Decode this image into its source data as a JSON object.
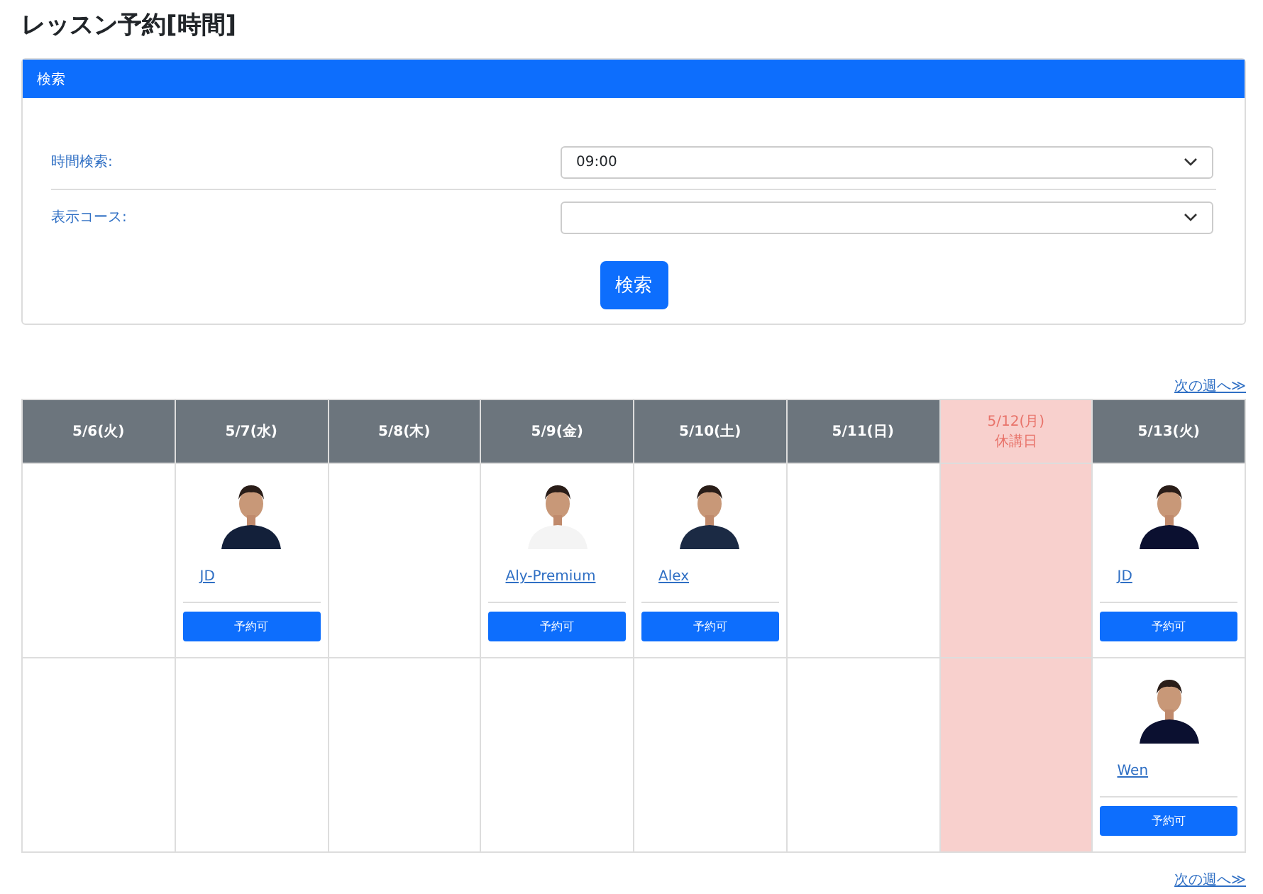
{
  "page": {
    "title": "レッスン予約[時間]"
  },
  "search": {
    "header": "検索",
    "fields": [
      {
        "label": "時間検索:",
        "value": "09:00"
      },
      {
        "label": "表示コース:"
      }
    ],
    "button": "検索"
  },
  "next_week_top": "次の週へ≫",
  "schedule": {
    "columns": [
      {
        "date": "5/6(火)",
        "holiday": false
      },
      {
        "date": "5/7(水)",
        "holiday": false
      },
      {
        "date": "5/8(木)",
        "holiday": false
      },
      {
        "date": "5/9(金)",
        "holiday": false
      },
      {
        "date": "5/10(土)",
        "holiday": false
      },
      {
        "date": "5/11(日)",
        "holiday": false
      },
      {
        "date": "5/12(月)",
        "holiday": true,
        "note": "休講日"
      },
      {
        "date": "5/13(火)",
        "holiday": false
      }
    ],
    "rows": [
      {
        "cells": [
          {
            "kind": "empty"
          },
          {
            "kind": "lesson",
            "teacher": "JD",
            "button": "予約可"
          },
          {
            "kind": "empty"
          },
          {
            "kind": "lesson",
            "teacher": "Aly-Premium",
            "button": "予約可"
          },
          {
            "kind": "lesson",
            "teacher": "Alex",
            "button": "予約可"
          },
          {
            "kind": "empty"
          },
          {
            "kind": "closed"
          },
          {
            "kind": "lesson",
            "teacher": "JD",
            "button": "予約可"
          }
        ]
      },
      {
        "cells": [
          {
            "kind": "empty"
          },
          {
            "kind": "empty"
          },
          {
            "kind": "empty"
          },
          {
            "kind": "empty"
          },
          {
            "kind": "empty"
          },
          {
            "kind": "empty"
          },
          {
            "kind": "closed"
          },
          {
            "kind": "lesson",
            "teacher": "Wen",
            "button": "予約可"
          }
        ]
      }
    ]
  },
  "next_week_bottom": "次の週へ≫"
}
